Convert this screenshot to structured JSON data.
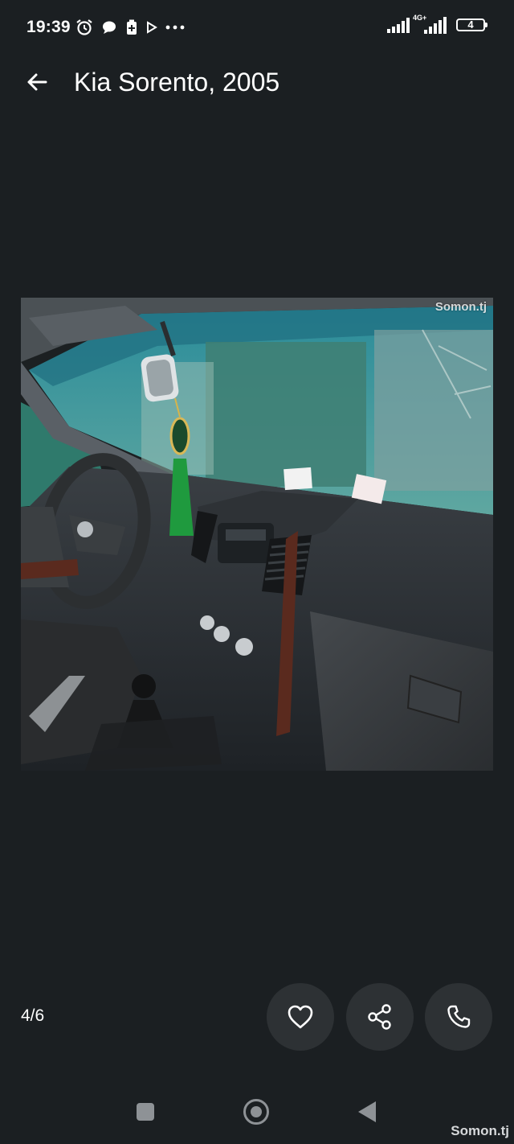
{
  "status_bar": {
    "time": "19:39",
    "network": "4G+",
    "battery_level": "4",
    "left_icons": [
      "alarm-icon",
      "chat-bubble-icon",
      "battery-saver-icon",
      "play-icon",
      "more-dots-icon"
    ],
    "right_icons": [
      "signal-icon",
      "signal-4g-icon",
      "battery-icon"
    ]
  },
  "app_bar": {
    "title": "Kia Sorento, 2005",
    "back_icon": "arrow-left-icon"
  },
  "photo": {
    "watermark": "Somon.tj",
    "subject": "car-interior-photo"
  },
  "gallery": {
    "counter": "4/6"
  },
  "actions": [
    {
      "name": "favorite",
      "icon": "heart-icon"
    },
    {
      "name": "share",
      "icon": "share-icon"
    },
    {
      "name": "call",
      "icon": "phone-icon"
    }
  ],
  "nav_bar": {
    "icons": [
      "square-recents-icon",
      "circle-home-icon",
      "triangle-back-icon"
    ],
    "watermark": "Somon.tj"
  },
  "colors": {
    "background": "#1b1f22",
    "button_bg": "#2d3134",
    "text": "#ffffff",
    "nav_icon": "#8e9296"
  }
}
